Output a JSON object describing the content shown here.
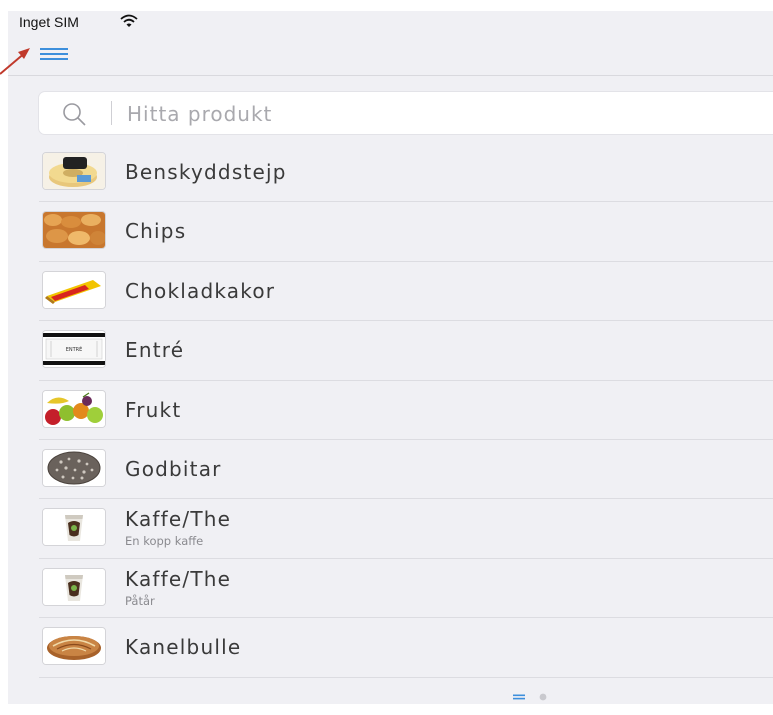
{
  "status_bar": {
    "carrier": "Inget SIM",
    "wifi_icon": "wifi-icon"
  },
  "nav": {
    "menu_icon": "hamburger-menu-icon",
    "accent_color": "#3d8fdc"
  },
  "search": {
    "placeholder": "Hitta produkt",
    "value": "",
    "icon": "search-icon"
  },
  "products": [
    {
      "name": "Benskyddstejp",
      "subtitle": "",
      "icon": "tape-roll-image"
    },
    {
      "name": "Chips",
      "subtitle": "",
      "icon": "chips-image"
    },
    {
      "name": "Chokladkakor",
      "subtitle": "",
      "icon": "chocolate-bar-image"
    },
    {
      "name": "Entré",
      "subtitle": "",
      "icon": "ticket-image"
    },
    {
      "name": "Frukt",
      "subtitle": "",
      "icon": "fruit-image"
    },
    {
      "name": "Godbitar",
      "subtitle": "",
      "icon": "candy-ball-image"
    },
    {
      "name": "Kaffe/The",
      "subtitle": "En kopp kaffe",
      "icon": "coffee-cup-image"
    },
    {
      "name": "Kaffe/The",
      "subtitle": "Påtår",
      "icon": "coffee-cup-image"
    },
    {
      "name": "Kanelbulle",
      "subtitle": "",
      "icon": "cinnamon-bun-image"
    }
  ],
  "thumb_labels": {
    "ticket": "ENTRÉ"
  },
  "page_indicator": {
    "pages": 2,
    "current": 1
  }
}
